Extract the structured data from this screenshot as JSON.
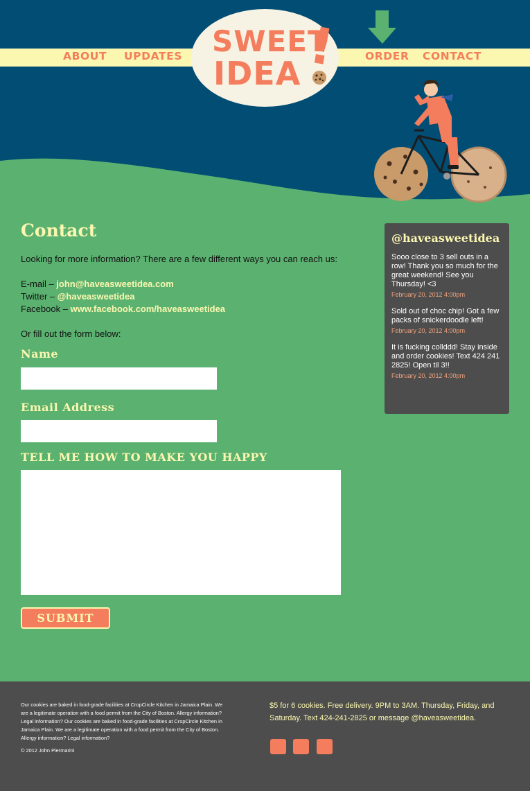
{
  "nav": {
    "about": "ABOUT",
    "updates": "UPDATES",
    "order": "ORDER",
    "contact": "CONTACT"
  },
  "logo": {
    "line1": "SWEET",
    "line2": "IDEA",
    "exclaim": "!"
  },
  "contact": {
    "title": "Contact",
    "intro": "Looking for more information? There are a few different ways you can reach us:",
    "email_label": "E-mail – ",
    "email": "john@haveasweetidea.com",
    "twitter_label": "Twitter – ",
    "twitter": "@haveasweetidea",
    "facebook_label": "Facebook – ",
    "facebook": "www.facebook.com/haveasweetidea",
    "form_intro": "Or fill out the form below:"
  },
  "form": {
    "name_label": "Name",
    "email_label": "Email Address",
    "message_label": "TELL ME HOW TO MAKE YOU HAPPY",
    "name_value": "",
    "email_value": "",
    "message_value": "",
    "submit_label": "SUBMIT"
  },
  "twitter_feed": {
    "title": "@haveasweetidea",
    "tweets": [
      {
        "text": "Sooo close to 3 sell outs in a row! Thank you so much for the great weekend! See you Thursday! <3",
        "date": "February 20, 2012 4:00pm"
      },
      {
        "text": "Sold out of choc chip! Got a few packs of snickerdoodle left!",
        "date": "February 20, 2012 4:00pm"
      },
      {
        "text": "It is fucking collddd! Stay inside and order cookies! Text 424 241 2825! Open til 3!!",
        "date": "February 20, 2012 4:00pm"
      }
    ]
  },
  "footer": {
    "legal": "Our cookies are baked in food-grade facilities at CropCircle Kitchen in Jamaica Plain. We are a legitimate operation with a food permit from the City of Boston. Allergy information? Legal information? Our cookies are baked in food-grade facilities at CropCircle Kitchen in Jamaica Plain. We are a legitimate operation with a food permit from the City of Boston. Allergy information? Legal information?",
    "copyright": "© 2012 John Piermarini",
    "info": "$5 for 6 cookies. Free delivery. 9PM to 3AM. Thursday, Friday, and Saturday. Text 424-241-2825 or message @haveasweetidea.",
    "social_icons": [
      "social-icon-1",
      "social-icon-2",
      "social-icon-3"
    ]
  },
  "colors": {
    "navy": "#024d74",
    "green": "#5bb270",
    "cream": "#fbf7b0",
    "coral": "#f47d5d",
    "dark": "#4d4d4d"
  }
}
